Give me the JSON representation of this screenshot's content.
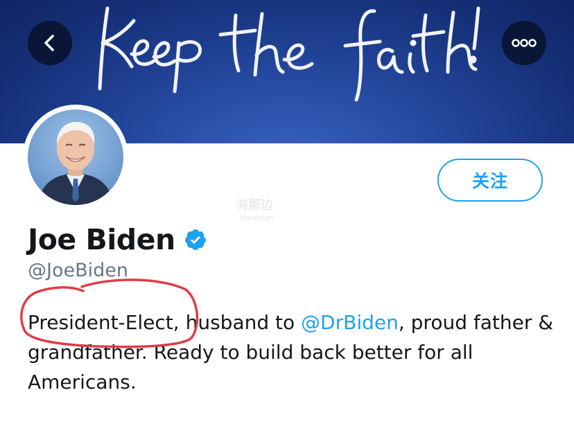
{
  "header": {
    "banner_text": "keep the faith!",
    "back_icon": "chevron-left-icon",
    "more_icon": "more-horizontal-icon",
    "banner_color": "#1b3a8c"
  },
  "profile": {
    "display_name": "Joe Biden",
    "handle": "@JoeBiden",
    "follow_label": "关注",
    "verified_icon": "verified-badge-icon",
    "bio": {
      "part1": "President-Elect,",
      "part2": " husband to ",
      "mention": "@DrBiden",
      "part3": ", proud father & grandfather. Ready to build back better for all Americans."
    }
  },
  "watermark": {
    "line1": "海那边",
    "line2": "Haiabian"
  },
  "colors": {
    "accent": "#1da1f2",
    "annotation": "#e03a46",
    "text": "#14171a",
    "secondary_text": "#657786"
  }
}
